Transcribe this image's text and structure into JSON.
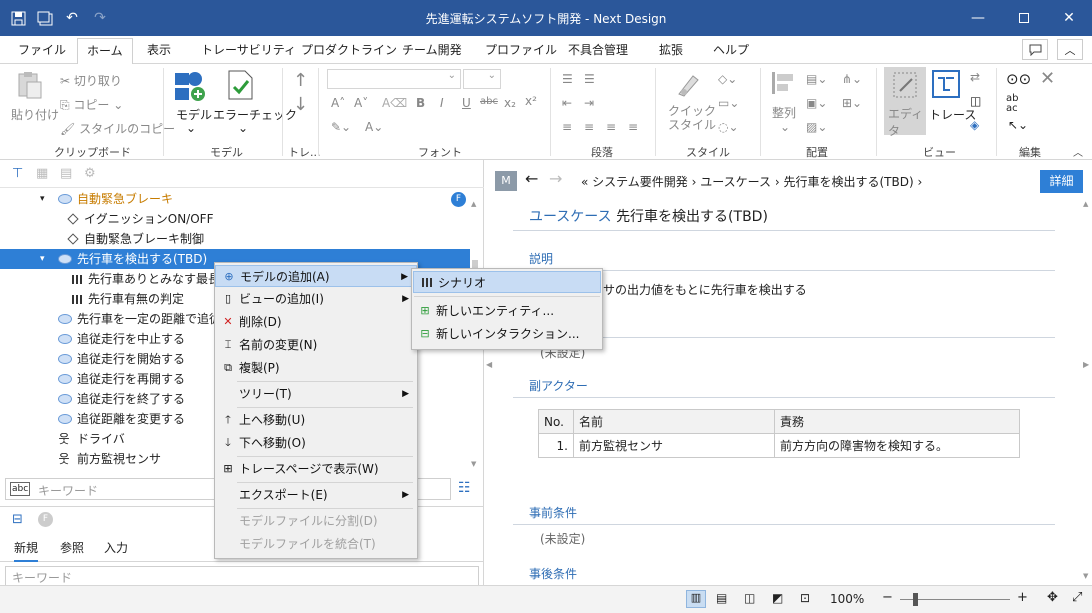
{
  "window": {
    "title": "先進運転システムソフト開発 - Next Design",
    "min_icon": "minimize-icon",
    "max_icon": "maximize-icon",
    "close_icon": "close-icon"
  },
  "menus": [
    "ファイル",
    "ホーム",
    "表示",
    "トレーサビリティ",
    "プロダクトライン",
    "チーム開発",
    "プロファイル",
    "不具合管理",
    "拡張",
    "ヘルプ"
  ],
  "active_menu": "ホーム",
  "ribbon": {
    "paste": "貼り付け",
    "cut": "切り取り",
    "copy": "コピー",
    "copy_style": "スタイルのコピー",
    "clipboard_group": "クリップボード",
    "model": "モデル",
    "error_check": "エラーチェック",
    "model_group": "モデル",
    "trace_group": "トレ...",
    "font_group": "フォント",
    "paragraph_group": "段落",
    "quick_style": "クイック\nスタイル",
    "style_group": "スタイル",
    "align": "整列",
    "layout_group": "配置",
    "editor": "エディタ",
    "trace": "トレース",
    "view_group": "ビュー",
    "edit_group": "編集",
    "font_bold": "B",
    "font_italic": "I",
    "font_underline": "U",
    "font_strike": "abc",
    "font_sub": "x₂",
    "font_sup": "x²"
  },
  "tree": {
    "items": [
      {
        "label": "自動緊急ブレーキ",
        "type": "usecase",
        "depth": 0,
        "expanded": true
      },
      {
        "label": "イグニッションON/OFF",
        "type": "diamond",
        "depth": 1
      },
      {
        "label": "自動緊急ブレーキ制御",
        "type": "diamond",
        "depth": 1
      },
      {
        "label": "先行車を検出する(TBD)",
        "type": "usecase",
        "depth": 0,
        "expanded": true,
        "selected": true
      },
      {
        "label": "先行車ありとみなす最長車",
        "type": "scenario",
        "depth": 1
      },
      {
        "label": "先行車有無の判定",
        "type": "scenario",
        "depth": 1
      },
      {
        "label": "先行車を一定の距離で追従",
        "type": "usecase",
        "depth": 0
      },
      {
        "label": "追従走行を中止する",
        "type": "usecase",
        "depth": 0
      },
      {
        "label": "追従走行を開始する",
        "type": "usecase",
        "depth": 0
      },
      {
        "label": "追従走行を再開する",
        "type": "usecase",
        "depth": 0
      },
      {
        "label": "追従走行を終了する",
        "type": "usecase",
        "depth": 0
      },
      {
        "label": "追従距離を変更する",
        "type": "usecase",
        "depth": 0
      },
      {
        "label": "ドライバ",
        "type": "actor",
        "depth": 0
      },
      {
        "label": "前方監視センサ",
        "type": "actor",
        "depth": 0
      }
    ],
    "badge": "F",
    "search_placeholder": "キーワード"
  },
  "lower_panel": {
    "tabs": [
      "新規",
      "参照",
      "入力"
    ],
    "search_placeholder": "キーワード",
    "badge": "F"
  },
  "context_menu": {
    "items": [
      {
        "label": "モデルの追加(A)",
        "has_sub": true,
        "highlight": true,
        "icon": "add-model-icon"
      },
      {
        "label": "ビューの追加(I)",
        "has_sub": true,
        "icon": "add-view-icon"
      },
      {
        "label": "削除(D)",
        "icon": "delete-icon"
      },
      {
        "label": "名前の変更(N)",
        "icon": "rename-icon"
      },
      {
        "label": "複製(P)",
        "icon": "duplicate-icon"
      },
      {
        "label": "ツリー(T)",
        "has_sub": true
      },
      {
        "label": "上へ移動(U)",
        "icon": "arrow-up-icon"
      },
      {
        "label": "下へ移動(O)",
        "icon": "arrow-down-icon"
      },
      {
        "label": "トレースページで表示(W)",
        "icon": "trace-page-icon"
      },
      {
        "label": "エクスポート(E)",
        "has_sub": true
      },
      {
        "label": "モデルファイルに分割(D)",
        "disabled": true
      },
      {
        "label": "モデルファイルを統合(T)",
        "disabled": true
      }
    ]
  },
  "submenu": {
    "items": [
      {
        "label": "シナリオ",
        "highlight": true
      },
      {
        "label": "新しいエンティティ..."
      },
      {
        "label": "新しいインタラクション..."
      }
    ]
  },
  "detail": {
    "badge": "M",
    "breadcrumb": [
      "システム要件開発",
      "ユースケース",
      "先行車を検出する(TBD)"
    ],
    "detail_button": "詳細",
    "heading_type": "ユースケース",
    "heading_name": "先行車を検出する(TBD)",
    "description_label": "説明",
    "description_text": "サの出力値をもとに先行車を検出する",
    "unset1": "(未設定)",
    "sub_actor_label": "副アクター",
    "table": {
      "headers": [
        "No.",
        "名前",
        "責務"
      ],
      "rows": [
        [
          "1.",
          "前方監視センサ",
          "前方方向の障害物を検知する。"
        ]
      ]
    },
    "precondition_label": "事前条件",
    "unset2": "(未設定)",
    "postcondition_label": "事後条件"
  },
  "status": {
    "zoom": "100%",
    "zoom_minus": "−",
    "zoom_plus": "+"
  },
  "colors": {
    "titlebar": "#2b579a",
    "selected": "#2e7fd6",
    "accent": "#2e6db4"
  }
}
